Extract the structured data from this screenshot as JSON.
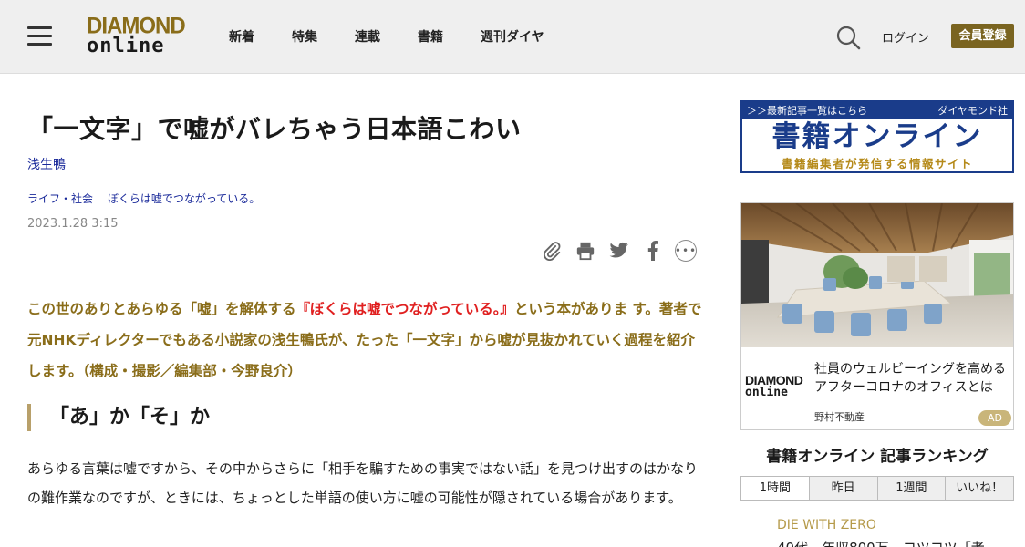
{
  "header": {
    "logo_line1": "DIAMOND",
    "logo_line2": "online",
    "nav": [
      "新着",
      "特集",
      "連載",
      "書籍",
      "週刊ダイヤ"
    ],
    "login": "ログイン",
    "register": "会員登録"
  },
  "article": {
    "title": "「一文字」で嘘がバレちゃう日本語こわい",
    "author": "浅生鴨",
    "categories": [
      "ライフ・社会",
      "ぼくらは嘘でつながっている。"
    ],
    "date": "2023.1.28 3:15",
    "lead_part1": "この世のありとあらゆる「嘘」を解体する",
    "lead_highlight": "『ぼくらは嘘でつながっている。』",
    "lead_part2": "という本がありま す。著者で元NHKディレクターでもある小説家の浅生鴨氏が、たった「一文字」から嘘が見抜かれていく過程を紹介します。（構成・撮影／編集部・今野良介）",
    "heading": "「あ」か「そ」か",
    "body": "あらゆる言葉は嘘ですから、その中からさらに「相手を騙すための事実ではない話」を見つけ出すのはかなりの難作業なのですが、ときには、ちょっとした単語の使い方に嘘の可能性が隠されている場合があります。"
  },
  "sidebar": {
    "banner_top_left": "＞＞最新記事一覧はこちら",
    "banner_top_right": "ダイヤモンド社",
    "banner_main": "書籍オンライン",
    "banner_sub": "書籍編集者が発信する情報サイト",
    "ad_logo_line1": "DIAMOND",
    "ad_logo_line2": "online",
    "ad_text_line1": "社員のウェルビーイングを高める",
    "ad_text_line2": "アフターコロナのオフィスとは",
    "ad_sponsor": "野村不動産",
    "ad_badge": "AD",
    "ranking_title": "書籍オンライン 記事ランキング",
    "ranking_tabs": [
      "1時間",
      "昨日",
      "1週間",
      "いいね！"
    ],
    "ranking_item_tag": "DIE WITH ZERO",
    "ranking_item_text": "40代　年収800万…コツコツ「老"
  }
}
